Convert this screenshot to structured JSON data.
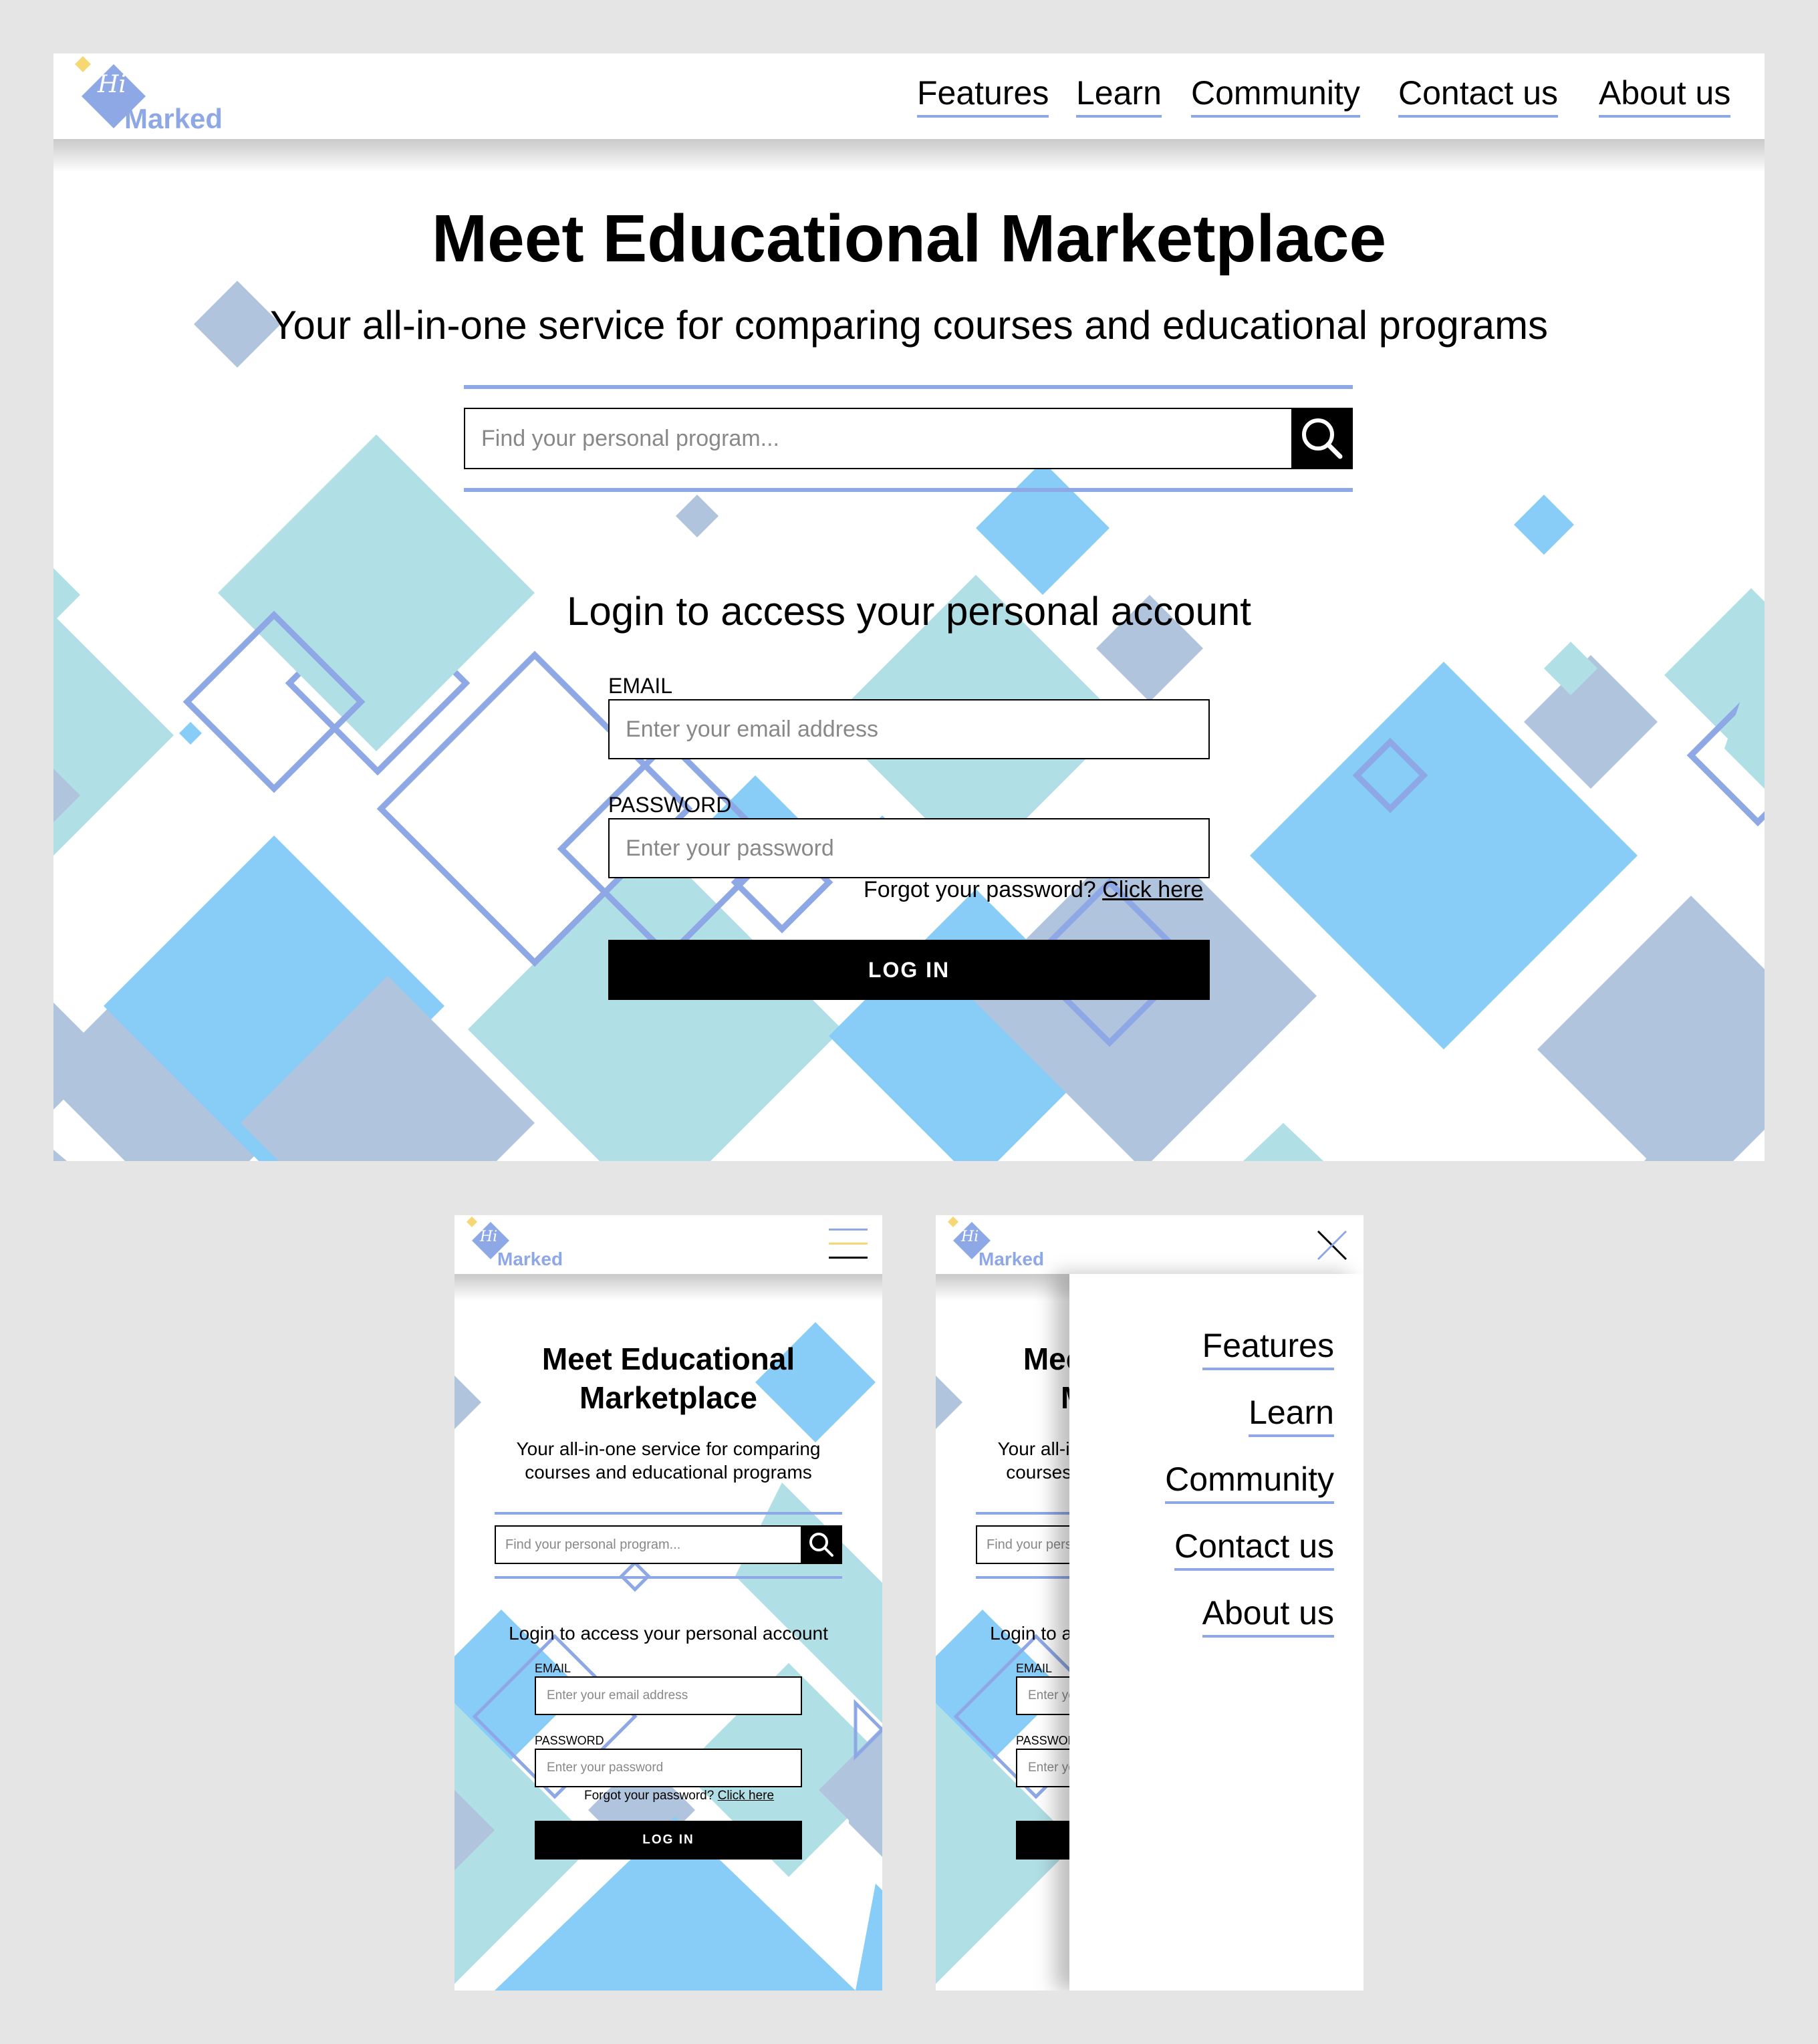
{
  "brand": {
    "logo_script": "Hi",
    "logo_word": "Marked"
  },
  "nav": {
    "links": [
      "Features",
      "Learn",
      "Community",
      "Contact us",
      "About us"
    ]
  },
  "hero": {
    "title": "Meet Educational Marketplace",
    "title_line1": "Meet Educational",
    "title_line2": "Marketplace",
    "subtitle": "Your all-in-one service for comparing courses and educational programs",
    "subtitle_line1": "Your all-in-one service for comparing",
    "subtitle_line2": "courses and educational programs"
  },
  "search": {
    "placeholder": "Find your personal program..."
  },
  "login": {
    "heading": "Login to access your personal account",
    "email_label": "EMAIL",
    "email_placeholder": "Enter your email address",
    "password_label": "PASSWORD",
    "password_placeholder": "Enter your password",
    "forgot_text": "Forgot your password?",
    "forgot_link": "Click here",
    "button": "LOG IN"
  },
  "mobile_menu": {
    "links": [
      "Features",
      "Learn",
      "Community",
      "Contact us",
      "About us"
    ]
  },
  "colors": {
    "accent": "#8ea8e6",
    "shape_blue": "#87cdf8",
    "shape_teal": "#b0dfe5",
    "shape_grey": "#b0c4de",
    "logo_yellow": "#f7d774",
    "page_bg": "#e5e5e5"
  },
  "icons": [
    "search-icon",
    "hamburger-icon",
    "close-icon",
    "logo-icon"
  ]
}
